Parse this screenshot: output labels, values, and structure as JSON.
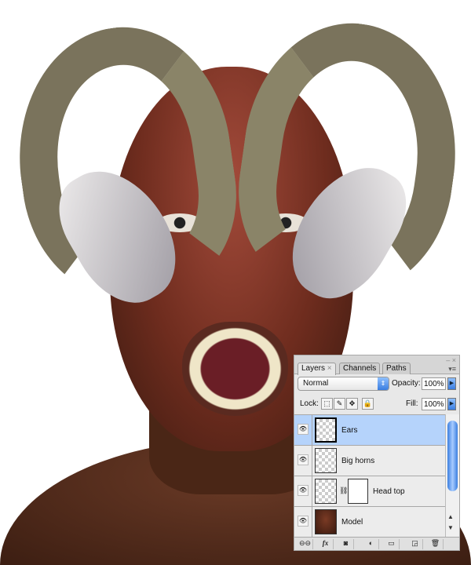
{
  "image": {
    "subject": "horned-face-composite"
  },
  "panel": {
    "tabs": [
      {
        "label": "Layers",
        "close": "×"
      },
      {
        "label": "Channels"
      },
      {
        "label": "Paths"
      }
    ],
    "window_controls": "– ×",
    "blend_mode": "Normal",
    "opacity_label": "Opacity:",
    "opacity_value": "100%",
    "lock_label": "Lock:",
    "fill_label": "Fill:",
    "fill_value": "100%",
    "layers": [
      {
        "name": "Ears",
        "selected": true
      },
      {
        "name": "Big horns",
        "selected": false
      },
      {
        "name": "Head top",
        "selected": false,
        "has_mask": true
      },
      {
        "name": "Model",
        "selected": false
      }
    ],
    "bottom_buttons": [
      "link",
      "fx",
      "mask",
      "adjustment",
      "group",
      "new",
      "delete"
    ],
    "fx_label": "fx"
  },
  "colors": {
    "selected_row": "#b5d3fb",
    "accent": "#3a7de0"
  }
}
